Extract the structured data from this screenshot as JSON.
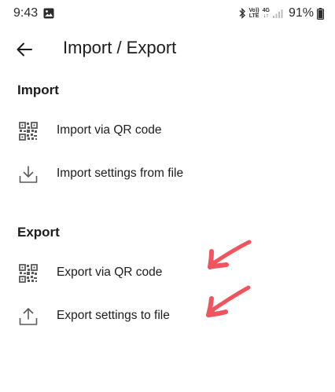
{
  "status_bar": {
    "time": "9:43",
    "network_top": "Vo))",
    "network_bottom": "LTE",
    "data_top": "4G",
    "data_bottom": "↓↑",
    "battery": "91%",
    "icons": [
      "gallery-icon",
      "bluetooth-icon",
      "signal-icon",
      "battery-icon"
    ]
  },
  "app_bar": {
    "title": "Import / Export",
    "back_icon": "arrow-back-icon"
  },
  "sections": {
    "import": {
      "header": "Import",
      "items": [
        {
          "label": "Import via QR code",
          "icon": "qr-code-icon"
        },
        {
          "label": "Import settings from file",
          "icon": "download-icon"
        }
      ]
    },
    "export": {
      "header": "Export",
      "items": [
        {
          "label": "Export via QR code",
          "icon": "qr-code-icon"
        },
        {
          "label": "Export settings to file",
          "icon": "upload-icon"
        }
      ]
    }
  },
  "annotations": {
    "arrow_color": "#f0555f"
  },
  "colors": {
    "background": "#ffffff",
    "text": "#1c1c1c",
    "icon": "#5a5a5a"
  }
}
